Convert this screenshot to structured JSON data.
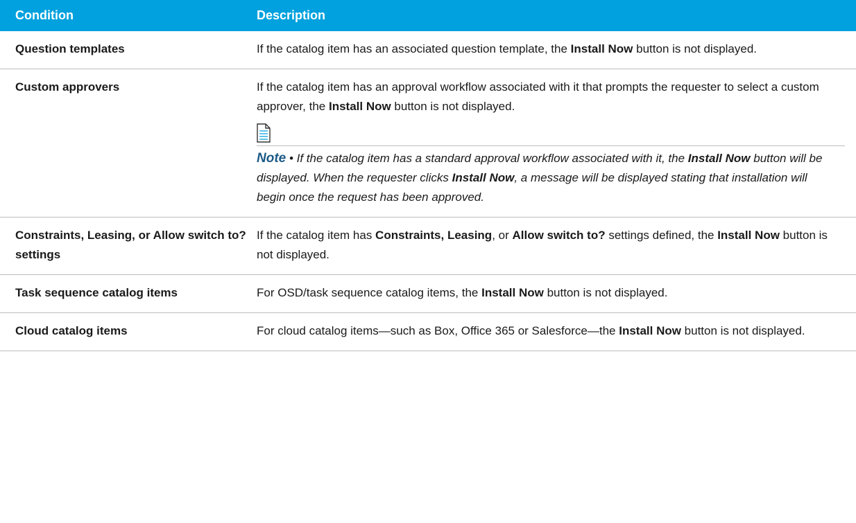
{
  "table": {
    "headers": {
      "condition": "Condition",
      "description": "Description"
    },
    "rows": [
      {
        "condition": "Question templates",
        "description": {
          "prefix": "If the catalog item has an associated question template, the ",
          "bold": "Install Now",
          "suffix": " button is not displayed."
        }
      },
      {
        "condition": "Custom approvers",
        "description": {
          "prefix": "If the catalog item has an approval workflow associated with it that prompts the requester to select a custom approver, the ",
          "bold": "Install Now",
          "suffix": " button is not displayed."
        },
        "note": {
          "icon": "note-document-icon",
          "label": "Note",
          "bullet": " • ",
          "text_1": "If the catalog item has a standard approval workflow associated with it, the ",
          "bold_1": "Install Now",
          "text_2": " button will be displayed. When the requester clicks ",
          "bold_2": "Install Now",
          "text_3": ", a message will be displayed stating that installation will begin once the request has been approved."
        }
      },
      {
        "condition": "Constraints, Leasing, or Allow switch to? settings",
        "description": {
          "prefix": "If the catalog item has ",
          "bold_1": "Constraints, Leasing",
          "mid_1": ", or ",
          "bold_2": "Allow switch to?",
          "mid_2": " settings defined, the ",
          "bold_3": "Install Now",
          "suffix": " button is not displayed."
        }
      },
      {
        "condition": "Task sequence catalog items",
        "description": {
          "prefix": "For OSD/task sequence catalog items, the ",
          "bold": "Install Now",
          "suffix": " button is not displayed."
        }
      },
      {
        "condition": "Cloud catalog items",
        "description": {
          "prefix": "For cloud catalog items—such as Box, Office 365 or Salesforce—the ",
          "bold": "Install Now",
          "suffix": " button is not displayed."
        }
      }
    ]
  },
  "colors": {
    "header_background": "#00a1de",
    "header_text": "#ffffff",
    "note_label": "#1b5a86",
    "row_divider": "#bdbdbd"
  }
}
